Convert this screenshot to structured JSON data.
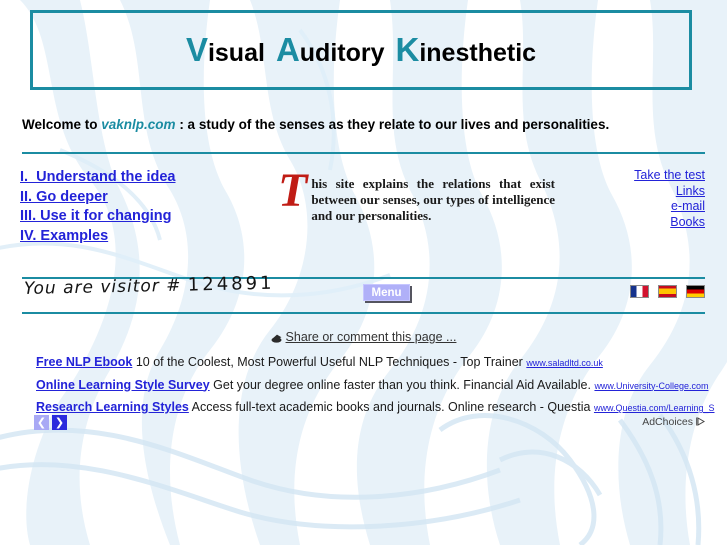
{
  "header": {
    "title_parts": [
      {
        "cap": "V",
        "rest": "isual"
      },
      {
        "cap": "A",
        "rest": "uditory"
      },
      {
        "cap": "K",
        "rest": "inesthetic"
      }
    ],
    "title_plain": "Visual Auditory Kinesthetic",
    "border_color": "#1b8ca2",
    "accent_color": "#1b8ca2"
  },
  "welcome": {
    "before": "Welcome to ",
    "site": "vaknlp.com",
    "after": " : a study of the senses as they relate to our lives and personalities."
  },
  "nav": {
    "items": [
      {
        "label": "I.  Understand the idea"
      },
      {
        "label": "II. Go deeper"
      },
      {
        "label": "III. Use it for changing"
      },
      {
        "label": "IV. Examples"
      }
    ],
    "link_color": "#2323d8"
  },
  "intro": {
    "dropcap": "T",
    "dropcap_color": "#c01c15",
    "text": "his site explains the relations that exist between our senses, our types of intelligence and our personalities."
  },
  "side_links": {
    "items": [
      {
        "label": "Take the test"
      },
      {
        "label": "Links"
      },
      {
        "label": "e-mail"
      },
      {
        "label": "Books"
      }
    ]
  },
  "visitor": {
    "text": "You are visitor # ",
    "count": "124891"
  },
  "menu_button": {
    "label": "Menu",
    "bg_color": "#b0b0f8"
  },
  "flags": [
    {
      "name": "french-flag",
      "title": "Français"
    },
    {
      "name": "spanish-flag",
      "title": "Español"
    },
    {
      "name": "german-flag",
      "title": "Deutsch"
    }
  ],
  "share": {
    "label": "Share or comment this page ...",
    "icon": "share-icon"
  },
  "ads": {
    "items": [
      {
        "title": "Free NLP Ebook",
        "description": "10 of the Coolest, Most Powerful Useful NLP Techniques - Top Trainer",
        "url": "www.saladltd.co.uk"
      },
      {
        "title": "Online Learning Style Survey",
        "description": "Get your degree online faster than you think. Financial Aid Available.",
        "url": "www.University-College.com"
      },
      {
        "title": "Research Learning Styles",
        "description": "Access full-text academic books and journals. Online research - Questia",
        "url": "www.Questia.com/Learning_S"
      }
    ],
    "prev_label": "❮",
    "next_label": "❯",
    "adchoices_label": "AdChoices"
  }
}
